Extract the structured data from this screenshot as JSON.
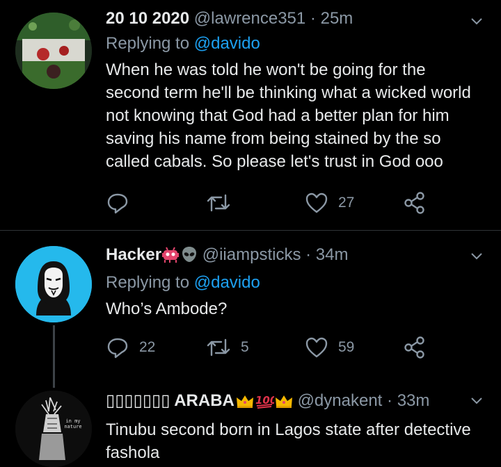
{
  "tweets": [
    {
      "name": "20 10 2020",
      "handle": "@lawrence351",
      "dot": "·",
      "time": "25m",
      "reply_prefix": "Replying to",
      "reply_to": "@davido",
      "text": "When he was told he won't be going for the second term he'll be thinking what a wicked world not knowing that God had a better plan for him saving his name from being stained by the so called cabals. So please let's trust in God ooo",
      "reply_count": "",
      "retweet_count": "",
      "like_count": "27"
    },
    {
      "name": "Hacker",
      "handle": "@iiampsticks",
      "dot": "·",
      "time": "34m",
      "reply_prefix": "Replying to",
      "reply_to": "@davido",
      "text": "Who’s Ambode?",
      "reply_count": "22",
      "retweet_count": "5",
      "like_count": "59"
    },
    {
      "name": "▯▯▯▯▯▯▯ ARABA",
      "handle": "@dynakent",
      "dot": "·",
      "time": "33m",
      "avatar_text": "in my nature",
      "text": "Tinubu second born in Lagos state  after detective fashola"
    }
  ],
  "colors": {
    "background": "#000000",
    "mention": "#1da1f2",
    "muted": "#8b98a5",
    "text": "#e7e9ea",
    "divider": "#2f3336"
  },
  "icons": [
    "reply-icon",
    "retweet-icon",
    "like-icon",
    "share-icon",
    "chevron-down-icon"
  ]
}
